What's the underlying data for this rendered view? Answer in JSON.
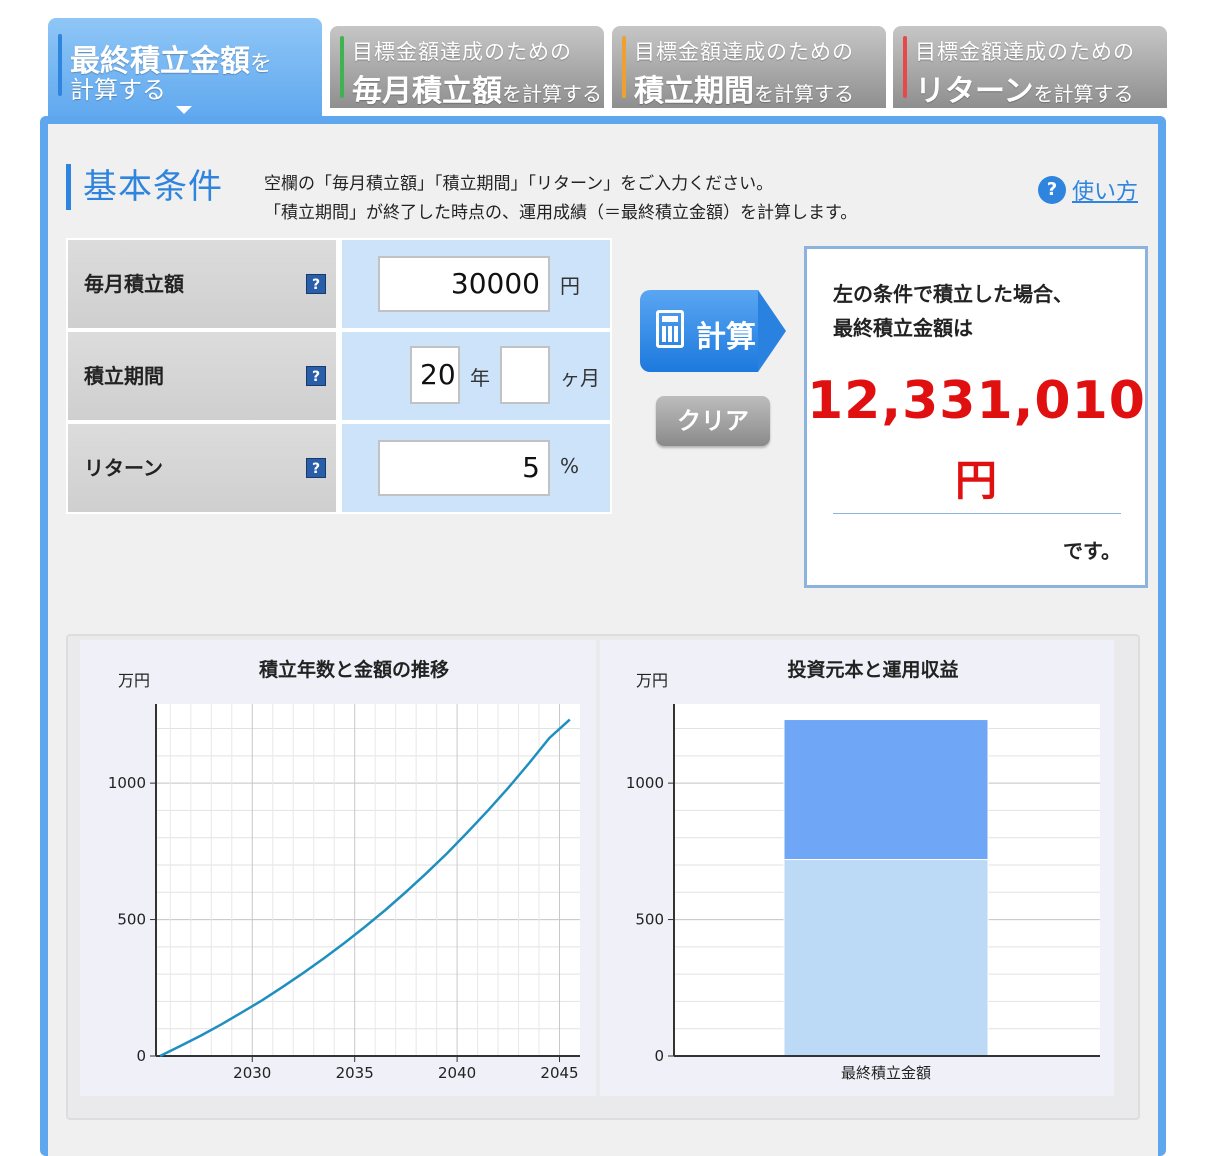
{
  "tabs": [
    {
      "line1_big": "最終積立金額",
      "line1_small": "を",
      "line2": "計算する",
      "active": true
    },
    {
      "line1": "目標金額達成のための",
      "line2_big": "毎月積立額",
      "line2_small": "を計算する",
      "color": "#3fb34f"
    },
    {
      "line1": "目標金額達成のための",
      "line2_big": "積立期間",
      "line2_small": "を計算する",
      "color": "#f0a030"
    },
    {
      "line1": "目標金額達成のための",
      "line2_big": "リターン",
      "line2_small": "を計算する",
      "color": "#e84848"
    }
  ],
  "section": {
    "title": "基本条件",
    "desc_line1": "空欄の「毎月積立額」「積立期間」「リターン」をご入力ください。",
    "desc_line2": "「積立期間」が終了した時点の、運用成績（＝最終積立金額）を計算します。",
    "help_label": "使い方"
  },
  "form": {
    "monthly": {
      "label": "毎月積立額",
      "value": "30000",
      "unit": "円"
    },
    "period": {
      "label": "積立期間",
      "years": "20",
      "years_unit": "年",
      "months": "",
      "months_unit": "ヶ月"
    },
    "return": {
      "label": "リターン",
      "value": "5",
      "unit": "%"
    },
    "help_icon": "?"
  },
  "buttons": {
    "calc": "計算",
    "clear": "クリア"
  },
  "result": {
    "line1": "左の条件で積立した場合、",
    "line2": "最終積立金額は",
    "amount": "12,331,010",
    "yen": "円",
    "suffix": "です。"
  },
  "charts": {
    "colors": {
      "line": "#1f8fc0",
      "principal": "#bcd9f5",
      "gain": "#6fa6f5"
    }
  },
  "chart_data": [
    {
      "type": "line",
      "title": "積立年数と金額の推移",
      "ylabel": "万円",
      "xlabel": "",
      "x": [
        2025.5,
        2026.5,
        2027.5,
        2028.5,
        2029.5,
        2030.5,
        2031.5,
        2032.5,
        2033.5,
        2034.5,
        2035.5,
        2036.5,
        2037.5,
        2038.5,
        2039.5,
        2040.5,
        2041.5,
        2042.5,
        2043.5,
        2044.5,
        2045.5
      ],
      "series": [
        {
          "values": [
            0,
            37,
            75,
            116,
            160,
            205,
            254,
            305,
            358,
            414,
            473,
            535,
            601,
            670,
            742,
            819,
            899,
            983,
            1072,
            1165,
            1233
          ]
        }
      ],
      "xticks": [
        2030,
        2035,
        2040,
        2045
      ],
      "yticks": [
        0,
        500,
        1000
      ],
      "xlim": [
        2025.3,
        2046
      ],
      "ylim": [
        0,
        1290
      ],
      "grid": true
    },
    {
      "type": "bar",
      "title": "投資元本と運用収益",
      "ylabel": "万円",
      "categories": [
        "最終積立金額"
      ],
      "series": [
        {
          "values": [
            720
          ]
        },
        {
          "values": [
            513
          ]
        }
      ],
      "stacked": true,
      "yticks": [
        0,
        500,
        1000
      ],
      "ylim": [
        0,
        1290
      ],
      "grid": true
    }
  ]
}
